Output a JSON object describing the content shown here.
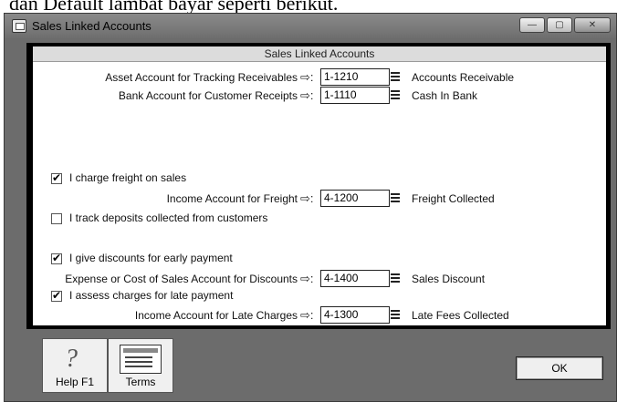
{
  "page": {
    "top_text": "dan Default lambat bayar seperti berikut."
  },
  "window": {
    "title": "Sales Linked Accounts",
    "controls": {
      "minimize": "—",
      "maximize": "▢",
      "close": "✕"
    }
  },
  "panel": {
    "header": "Sales Linked Accounts",
    "arrow_glyph": "⇨:",
    "rows": {
      "receivables": {
        "label": "Asset Account for Tracking Receivables",
        "account": "1-1210",
        "name": "Accounts Receivable"
      },
      "receipts": {
        "label": "Bank Account for Customer Receipts",
        "account": "1-1110",
        "name": "Cash In Bank"
      },
      "freight": {
        "label": "Income Account for Freight",
        "account": "4-1200",
        "name": "Freight Collected"
      },
      "discounts": {
        "label": "Expense or Cost of Sales Account for Discounts",
        "account": "4-1400",
        "name": "Sales Discount"
      },
      "late_charges": {
        "label": "Income Account for Late Charges",
        "account": "4-1300",
        "name": "Late Fees Collected"
      }
    },
    "checkboxes": {
      "charge_freight": {
        "label": "I charge freight on sales",
        "checked": true
      },
      "track_deposits": {
        "label": "I track deposits collected from customers",
        "checked": false
      },
      "early_discounts": {
        "label": "I give discounts for early payment",
        "checked": true
      },
      "late_payment": {
        "label": "I assess charges for late payment",
        "checked": true
      }
    }
  },
  "buttons": {
    "help": {
      "label": "Help F1",
      "icon": "question-mark-icon"
    },
    "terms": {
      "label": "Terms",
      "icon": "terms-card-icon"
    },
    "ok": {
      "label": "OK"
    }
  }
}
